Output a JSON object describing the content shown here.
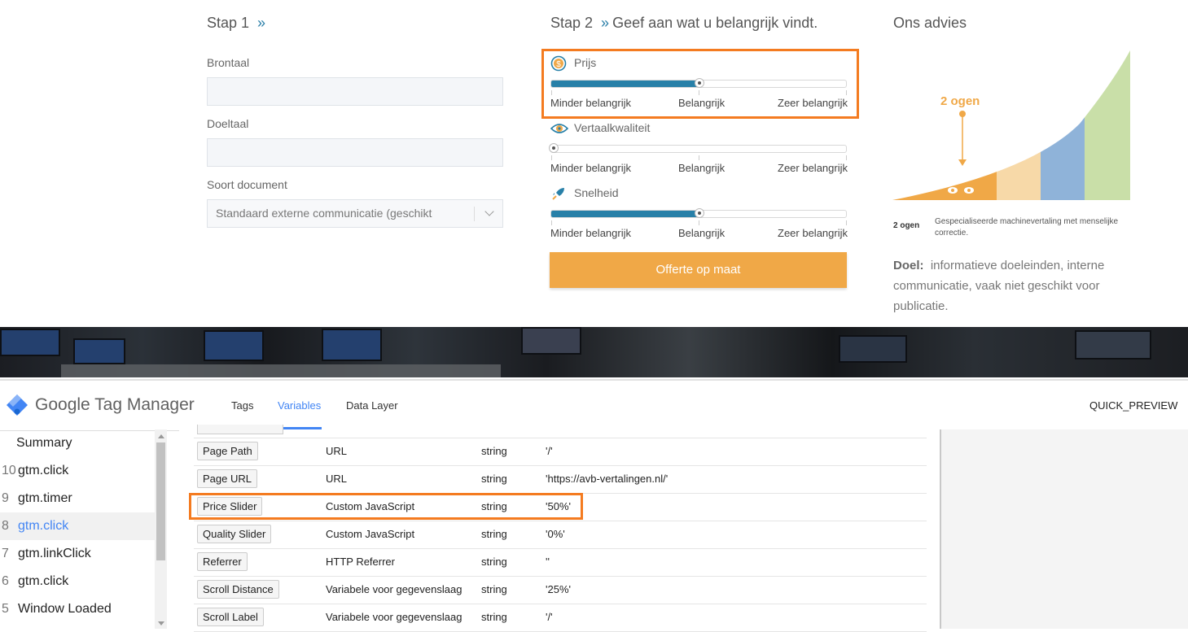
{
  "website": {
    "step1": {
      "title": "Stap 1",
      "chevron": "»",
      "source_label": "Brontaal",
      "target_label": "Doeltaal",
      "doc_type_label": "Soort document",
      "doc_type_value": "Standaard externe communicatie (geschikt"
    },
    "step2": {
      "title": "Stap 2",
      "chevron": "»",
      "subtitle": "Geef aan wat u belangrijk vindt.",
      "sliders": [
        {
          "label": "Prijs",
          "icon": "dollar-icon",
          "value": 0.5
        },
        {
          "label": "Vertaalkwaliteit",
          "icon": "eye-icon",
          "value": 0.0
        },
        {
          "label": "Snelheid",
          "icon": "rocket-icon",
          "value": 0.5
        }
      ],
      "scale": {
        "low": "Minder belangrijk",
        "mid": "Belangrijk",
        "high": "Zeer belangrijk"
      },
      "cta": "Offerte op maat"
    },
    "advice": {
      "title": "Ons advies",
      "chart_label": "2 ogen",
      "legend_key": "2 ogen",
      "legend_text": "Gespecialiseerde machinevertaling met menselijke correctie.",
      "goal_label": "Doel:",
      "goal_text": "informatieve doeleinden, interne communicatie, vaak niet geschikt voor publicatie."
    },
    "colors": {
      "accent_blue": "#2880a8",
      "accent_orange": "#f0a847",
      "highlight": "#f47b20"
    }
  },
  "gtm": {
    "brand": "Google Tag Manager",
    "tabs": [
      "Tags",
      "Variables",
      "Data Layer"
    ],
    "active_tab": "Variables",
    "right_label": "QUICK_PREVIEW",
    "sidebar": [
      {
        "num": "",
        "label": "Summary"
      },
      {
        "num": "10",
        "label": "gtm.click"
      },
      {
        "num": "9",
        "label": "gtm.timer"
      },
      {
        "num": "8",
        "label": "gtm.click",
        "selected": true
      },
      {
        "num": "7",
        "label": "gtm.linkClick"
      },
      {
        "num": "6",
        "label": "gtm.click"
      },
      {
        "num": "5",
        "label": "Window Loaded"
      }
    ],
    "variables": [
      {
        "name": "Page Path",
        "type": "URL",
        "return": "string",
        "value": "'/'"
      },
      {
        "name": "Page URL",
        "type": "URL",
        "return": "string",
        "value": "'https://avb-vertalingen.nl/'"
      },
      {
        "name": "Price Slider",
        "type": "Custom JavaScript",
        "return": "string",
        "value": "'50%'",
        "highlighted": true
      },
      {
        "name": "Quality Slider",
        "type": "Custom JavaScript",
        "return": "string",
        "value": "'0%'"
      },
      {
        "name": "Referrer",
        "type": "HTTP Referrer",
        "return": "string",
        "value": "''"
      },
      {
        "name": "Scroll Distance",
        "type": "Variabele voor gegevenslaag",
        "return": "string",
        "value": "'25%'"
      },
      {
        "name": "Scroll Label",
        "type": "Variabele voor gegevenslaag",
        "return": "string",
        "value": "'/'"
      }
    ]
  }
}
